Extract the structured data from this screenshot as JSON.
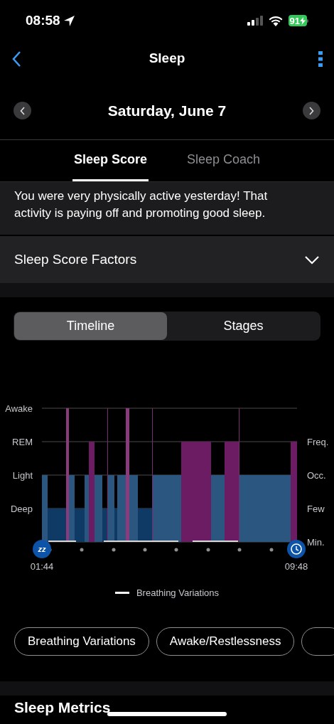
{
  "status_bar": {
    "time": "08:58",
    "battery": "91"
  },
  "nav": {
    "title": "Sleep"
  },
  "date_bar": {
    "date": "Saturday, June 7"
  },
  "tabs": [
    {
      "label": "Sleep Score",
      "selected": true
    },
    {
      "label": "Sleep Coach",
      "selected": false
    }
  ],
  "message": "You were very physically active yesterday! That activity is paying off and promoting good sleep.",
  "factors": {
    "label": "Sleep Score Factors",
    "expanded": false
  },
  "view_toggle": [
    {
      "label": "Timeline",
      "selected": true
    },
    {
      "label": "Stages",
      "selected": false
    }
  ],
  "timeline": {
    "stage_labels": [
      "Awake",
      "REM",
      "Light",
      "Deep"
    ],
    "breathing_labels": [
      "Freq.",
      "Occ.",
      "Few",
      "Min."
    ],
    "start_icon_text": "zz",
    "start_time": "01:44",
    "end_time": "09:48",
    "legend": "Breathing Variations"
  },
  "filter_chips": [
    "Breathing Variations",
    "Awake/Restlessness"
  ],
  "section_title": "Sleep Metrics"
}
